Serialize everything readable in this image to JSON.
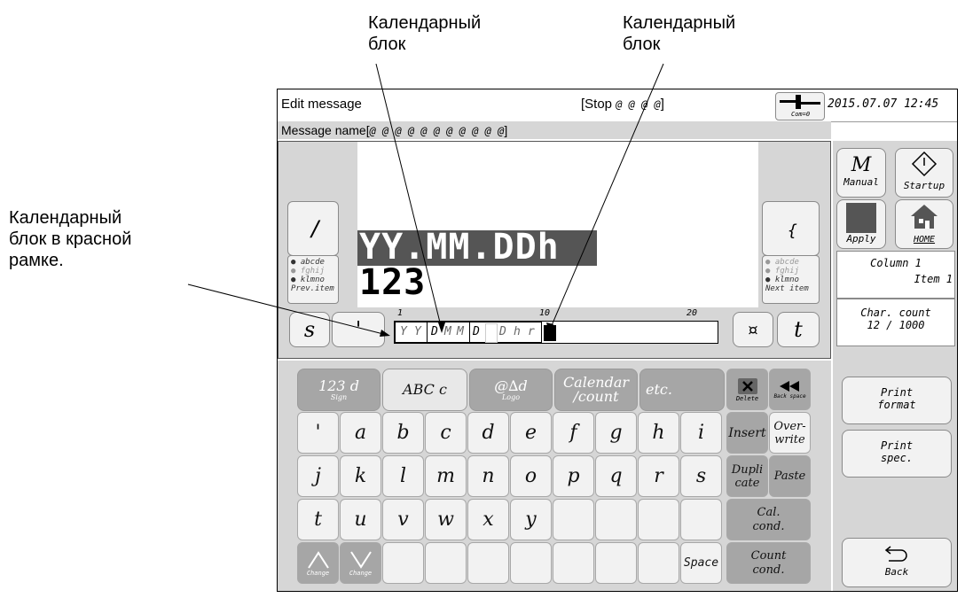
{
  "callouts": {
    "top_left": [
      "Календарный",
      "блок"
    ],
    "top_right": [
      "Календарный",
      "блок"
    ],
    "left": [
      "Календарный",
      "блок в красной",
      "рамке."
    ]
  },
  "header": {
    "title": "Edit message",
    "status_prefix": "[Stop ",
    "status_value": "@ @ @ @",
    "status_suffix": "]",
    "com_label": "Com=0",
    "datetime": "2015.07.07 12:45"
  },
  "message_name": {
    "label": "Message name[",
    "value": "@ @ @ @ @ @ @ @ @ @ @",
    "suffix": "]"
  },
  "editor": {
    "line1": "YY.MM.DDh",
    "line2": "123",
    "prev_btn_char": "/",
    "next_btn_char": "{",
    "left_options": [
      "abcde",
      "fghij",
      "klmno"
    ],
    "right_options": [
      "abcde",
      "fghij",
      "klmno"
    ],
    "prev_item": "Prev.item",
    "next_item": "Next item",
    "s_btn": "s",
    "apostrophe_btn": "'",
    "currency_btn": "¤",
    "t_btn": "t",
    "ruler": [
      "1",
      "10",
      "20"
    ],
    "cells": [
      "Y",
      "Y",
      "D",
      "M",
      "M",
      "D",
      "D",
      "h",
      "r"
    ]
  },
  "tabs": [
    {
      "label": "123 d",
      "sub": "Sign"
    },
    {
      "label": "ABC c",
      "sub": ""
    },
    {
      "label": "@∆d",
      "sub": "Logo"
    },
    {
      "label": "Calendar /count",
      "sub": ""
    },
    {
      "label": "etc.",
      "sub": ""
    }
  ],
  "keys": {
    "row1": [
      "'",
      "a",
      "b",
      "c",
      "d",
      "e",
      "f",
      "g",
      "h",
      "i"
    ],
    "row2": [
      "j",
      "k",
      "l",
      "m",
      "n",
      "o",
      "p",
      "q",
      "r",
      "s"
    ],
    "row3": [
      "t",
      "u",
      "v",
      "w",
      "x",
      "y",
      "",
      "",
      "",
      ""
    ],
    "row4_space": "Space",
    "change": "Change"
  },
  "edit_keys": {
    "delete": "Delete",
    "backspace": "Back space",
    "insert": "Insert",
    "overwrite_1": "Over-",
    "overwrite_2": "write",
    "duplicate_1": "Dupli",
    "duplicate_2": "cate",
    "paste": "Paste",
    "cal_cond_1": "Cal.",
    "cal_cond_2": "cond.",
    "count_cond_1": "Count",
    "count_cond_2": "cond."
  },
  "side": {
    "manual_big": "M",
    "manual": "Manual",
    "startup": "Startup",
    "apply": "Apply",
    "home": "HOME",
    "column": "Column 1",
    "item": "Item 1",
    "char_count_label": "Char. count",
    "char_count_value": "12 / 1000",
    "print_format_1": "Print",
    "print_format_2": "format",
    "print_spec_1": "Print",
    "print_spec_2": "spec.",
    "back": "Back"
  },
  "colors": {
    "panel": "#d6d6d6",
    "key": "#f2f2f2",
    "dark_key": "#a6a6a6"
  }
}
